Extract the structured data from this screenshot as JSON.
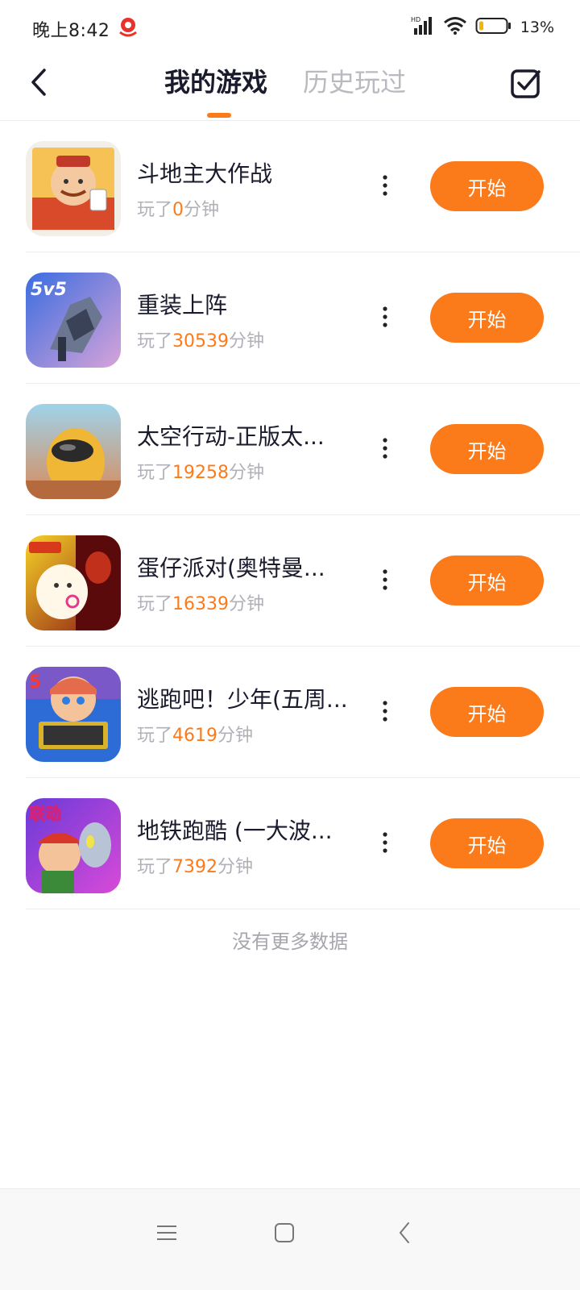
{
  "status_bar": {
    "time": "晚上8:42",
    "battery_percent": "13%",
    "battery_level": 0.13,
    "signal_label": "HD"
  },
  "header": {
    "tabs": [
      {
        "label": "我的游戏",
        "active": true
      },
      {
        "label": "历史玩过",
        "active": false
      }
    ]
  },
  "accent_color": "#fb7a1a",
  "games": [
    {
      "name": "斗地主大作战",
      "played_prefix": "玩了",
      "minutes": "0",
      "played_suffix": "分钟",
      "start_label": "开始",
      "icon": "doudizhu-game-icon"
    },
    {
      "name": "重装上阵",
      "played_prefix": "玩了",
      "minutes": "30539",
      "played_suffix": "分钟",
      "start_label": "开始",
      "icon": "mecha-game-icon",
      "icon_badge": "5v5"
    },
    {
      "name": "太空行动-正版太...",
      "played_prefix": "玩了",
      "minutes": "19258",
      "played_suffix": "分钟",
      "start_label": "开始",
      "icon": "space-action-game-icon"
    },
    {
      "name": "蛋仔派对(奥特曼...",
      "played_prefix": "玩了",
      "minutes": "16339",
      "played_suffix": "分钟",
      "start_label": "开始",
      "icon": "eggy-party-game-icon"
    },
    {
      "name": "逃跑吧！少年(五周...",
      "played_prefix": "玩了",
      "minutes": "4619",
      "played_suffix": "分钟",
      "start_label": "开始",
      "icon": "escape-boy-game-icon"
    },
    {
      "name": "地铁跑酷 (一大波...",
      "played_prefix": "玩了",
      "minutes": "7392",
      "played_suffix": "分钟",
      "start_label": "开始",
      "icon": "subway-surf-game-icon",
      "icon_badge": "联动"
    }
  ],
  "no_more_text": "没有更多数据",
  "nav_bar": {
    "icons": [
      "menu-icon",
      "home-icon",
      "back-icon"
    ]
  }
}
